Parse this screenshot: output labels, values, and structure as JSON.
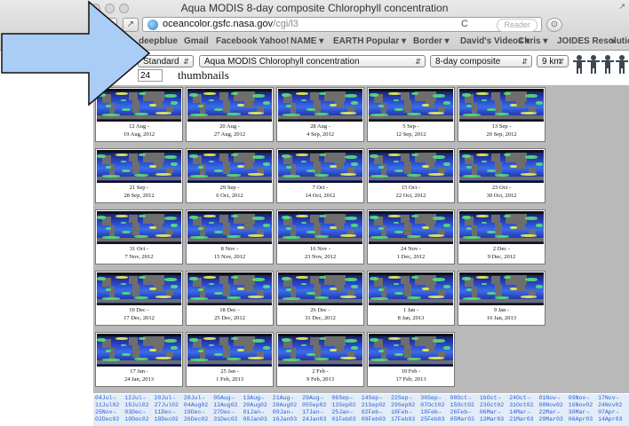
{
  "window": {
    "title": "Aqua MODIS 8-day composite Chlorophyll concentration",
    "resize_glyph": "↗"
  },
  "toolbar": {
    "url_host": "oceancolor.gsfc.nasa.gov",
    "url_path": "/cgi/l3",
    "reload_icon": "C",
    "reader_label": "Reader"
  },
  "bookmarks": [
    {
      "label": "deepblue"
    },
    {
      "label": "Gmail"
    },
    {
      "label": "Facebook"
    },
    {
      "label": "Yahoo!"
    },
    {
      "label": "NAME ▾"
    },
    {
      "label": "EARTH"
    },
    {
      "label": "Popular ▾"
    },
    {
      "label": "Border ▾"
    },
    {
      "label": "David's Videos ▾"
    },
    {
      "label": "Chris ▾"
    },
    {
      "label": "JOIDES Resolution"
    },
    {
      "label": "»"
    }
  ],
  "controls": {
    "standard": "Standard",
    "product": "Aqua MODIS Chlorophyll concentration",
    "period": "8-day composite",
    "resolution": "9 km",
    "thumb_count": "24",
    "thumb_label": "thumbnails"
  },
  "thumbnails": [
    {
      "line1": "12 Aug -",
      "line2": "19 Aug, 2012"
    },
    {
      "line1": "20 Aug -",
      "line2": "27 Aug, 2012"
    },
    {
      "line1": "28 Aug -",
      "line2": "4 Sep, 2012"
    },
    {
      "line1": "5 Sep -",
      "line2": "12 Sep, 2012"
    },
    {
      "line1": "13 Sep -",
      "line2": "20 Sep, 2012"
    },
    {
      "line1": "21 Sep -",
      "line2": "28 Sep, 2012"
    },
    {
      "line1": "29 Sep -",
      "line2": "6 Oct, 2012"
    },
    {
      "line1": "7 Oct -",
      "line2": "14 Oct, 2012"
    },
    {
      "line1": "15 Oct -",
      "line2": "22 Oct, 2012"
    },
    {
      "line1": "23 Oct -",
      "line2": "30 Oct, 2012"
    },
    {
      "line1": "31 Oct -",
      "line2": "7 Nov, 2012"
    },
    {
      "line1": "8 Nov -",
      "line2": "15 Nov, 2012"
    },
    {
      "line1": "16 Nov -",
      "line2": "23 Nov, 2012"
    },
    {
      "line1": "24 Nov -",
      "line2": "1 Dec, 2012"
    },
    {
      "line1": "2 Dec -",
      "line2": "9 Dec, 2012"
    },
    {
      "line1": "10 Dec -",
      "line2": "17 Dec, 2012"
    },
    {
      "line1": "18 Dec -",
      "line2": "25 Dec, 2012"
    },
    {
      "line1": "26 Dec -",
      "line2": "31 Dec, 2012"
    },
    {
      "line1": "1 Jan -",
      "line2": "8 Jan, 2013"
    },
    {
      "line1": "9 Jan -",
      "line2": "16 Jan, 2013"
    },
    {
      "line1": "17 Jan -",
      "line2": "24 Jan, 2013"
    },
    {
      "line1": "25 Jan -",
      "line2": "1 Feb, 2013"
    },
    {
      "line1": "2 Feb -",
      "line2": "9 Feb, 2013"
    },
    {
      "line1": "10 Feb -",
      "line2": "17 Feb, 2013"
    }
  ],
  "archive_links": {
    "row1": [
      "04Jul→",
      "12Jul→",
      "20Jul→",
      "28Jul→",
      "05Aug→",
      "13Aug→",
      "21Aug→",
      "29Aug→",
      "06Sep→",
      "14Sep→",
      "22Sep→",
      "30Sep→",
      "08Oct→",
      "16Oct→",
      "24Oct→",
      "01Nov→",
      "09Nov→",
      "17Nov→"
    ],
    "row2": [
      "11Jul02",
      "19Jul02",
      "27Jul02",
      "04Aug02",
      "12Aug02",
      "20Aug02",
      "28Aug02",
      "05Sep02",
      "13Sep02",
      "21Sep02",
      "29Sep02",
      "07Oct02",
      "15Oct02",
      "23Oct02",
      "31Oct02",
      "08Nov02",
      "16Nov02",
      "24Nov02"
    ],
    "row3": [
      "25Nov→",
      "03Dec→",
      "11Dec→",
      "19Dec→",
      "27Dec→",
      "01Jan→",
      "09Jan→",
      "17Jan→",
      "25Jan→",
      "02Feb→",
      "10Feb→",
      "18Feb→",
      "26Feb→",
      "06Mar→",
      "14Mar→",
      "22Mar→",
      "30Mar→",
      "07Apr→"
    ],
    "row4": [
      "02Dec02",
      "10Dec02",
      "18Dec02",
      "26Dec02",
      "31Dec02",
      "08Jan03",
      "16Jan03",
      "24Jan03",
      "01Feb03",
      "09Feb03",
      "17Feb03",
      "25Feb03",
      "05Mar03",
      "13Mar03",
      "21Mar03",
      "29Mar03",
      "06Apr03",
      "14Apr03"
    ]
  },
  "colors": {
    "arrow_fill": "#a9cdf5",
    "page_gray": "#b9b9b9",
    "link_blue": "#2a5fd6"
  }
}
